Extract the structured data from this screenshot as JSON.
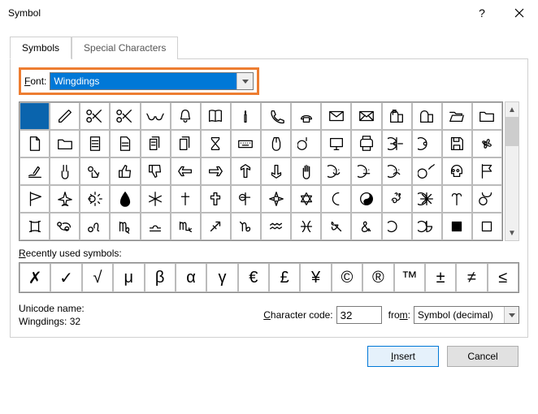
{
  "window": {
    "title": "Symbol"
  },
  "tabs": {
    "symbols": "Symbols",
    "special": "Special Characters"
  },
  "font": {
    "label_pre": "F",
    "label_post": "ont:",
    "value": "Wingdings"
  },
  "grid_icons": [
    "blank",
    "pencil",
    "scissors",
    "scissors2",
    "glasses",
    "bell",
    "book",
    "candle",
    "phone",
    "phone2",
    "envelope",
    "envelope2",
    "mailbox",
    "mailbox2",
    "folder-open",
    "folder",
    "file",
    "folder2",
    "doc",
    "doc2",
    "docs",
    "docs2",
    "hourglass",
    "keyboard",
    "mouse",
    "trackball",
    "pc",
    "printer",
    "disk1",
    "disk2",
    "floppy",
    "fan",
    "hand-write",
    "hand-v",
    "hand-ok",
    "thumb-up",
    "thumb-down",
    "hand-left",
    "hand-right",
    "hand-up",
    "hand-down",
    "hand-stop",
    "smile",
    "neutral",
    "frown",
    "bomb",
    "skull",
    "flag",
    "pennant",
    "plane",
    "sun",
    "drop",
    "snow",
    "cross-latin",
    "cross-outline",
    "cross-celtic",
    "cross-malta",
    "star-david",
    "crescent",
    "yinyang",
    "om",
    "wheel",
    "aries",
    "taurus",
    "gemini",
    "cancer",
    "leo",
    "virgo",
    "libra",
    "scorpio",
    "sagittarius",
    "capricorn",
    "aquarius",
    "pisces",
    "et",
    "amp",
    "circ1",
    "circ2",
    "square",
    "square2"
  ],
  "recent_label": "Recently used symbols:",
  "recent": [
    "✗",
    "✓",
    "√",
    "μ",
    "β",
    "α",
    "γ",
    "€",
    "£",
    "¥",
    "©",
    "®",
    "™",
    "±",
    "≠",
    "≤"
  ],
  "unicode_name_label": "Unicode name:",
  "unicode_name_value": "Wingdings: 32",
  "charcode_label_pre": "C",
  "charcode_label_post": "haracter code:",
  "charcode_value": "32",
  "from_label_pre": "fro",
  "from_label_post": ":",
  "from_label_u": "m",
  "from_value": "Symbol (decimal)",
  "buttons": {
    "insert": "Insert",
    "cancel": "Cancel"
  }
}
